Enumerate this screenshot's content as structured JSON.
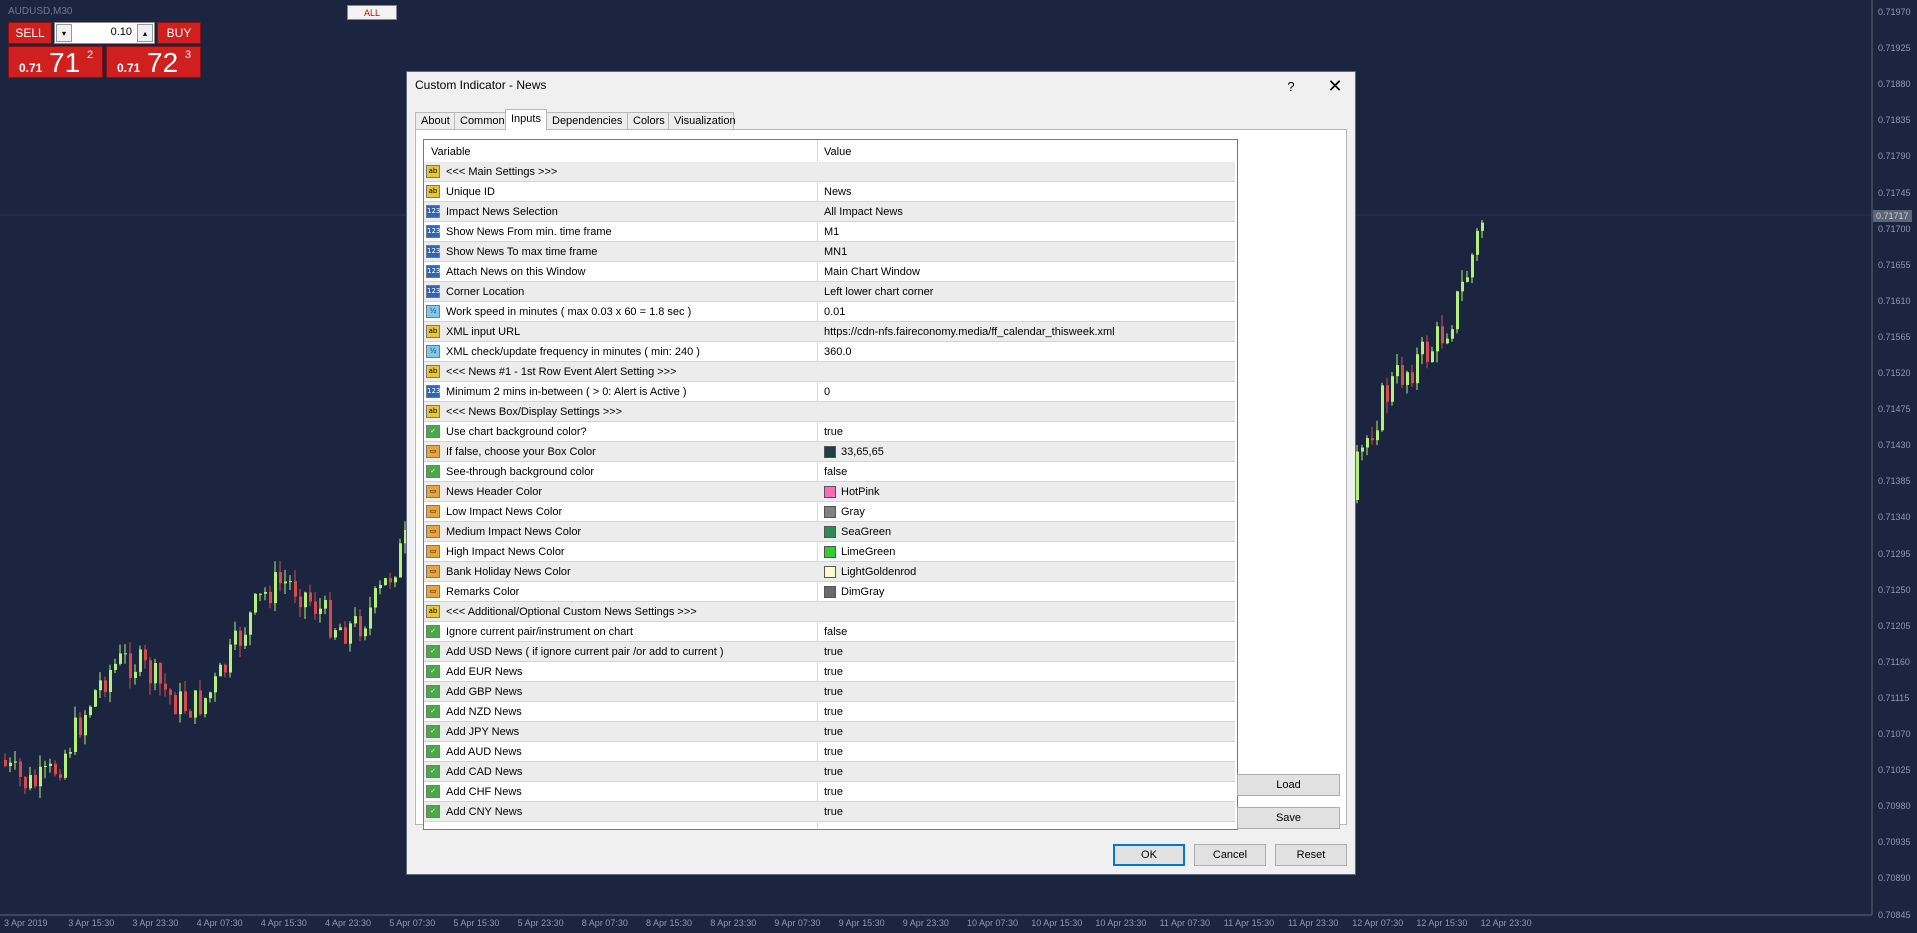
{
  "chart": {
    "symbol_title": "AUDUSD,M30",
    "all_button": "ALL",
    "price_labels": [
      "0.71970",
      "0.71925",
      "0.71880",
      "0.71835",
      "0.71790",
      "0.71745",
      "0.71700",
      "0.71655",
      "0.71610",
      "0.71565",
      "0.71520",
      "0.71475",
      "0.71430",
      "0.71385",
      "0.71340",
      "0.71295",
      "0.71250",
      "0.71205",
      "0.71160",
      "0.71115",
      "0.71070",
      "0.71025",
      "0.70980",
      "0.70935",
      "0.70890",
      "0.70845"
    ],
    "current_price": "0.71717",
    "time_labels": [
      "3 Apr 2019",
      "3 Apr 15:30",
      "3 Apr 23:30",
      "4 Apr 07:30",
      "4 Apr 15:30",
      "4 Apr 23:30",
      "5 Apr 07:30",
      "5 Apr 15:30",
      "5 Apr 23:30",
      "8 Apr 07:30",
      "8 Apr 15:30",
      "8 Apr 23:30",
      "9 Apr 07:30",
      "9 Apr 15:30",
      "9 Apr 23:30",
      "10 Apr 07:30",
      "10 Apr 15:30",
      "10 Apr 23:30",
      "11 Apr 07:30",
      "11 Apr 15:30",
      "11 Apr 23:30",
      "12 Apr 07:30",
      "12 Apr 15:30",
      "12 Apr 23:30"
    ],
    "colors": {
      "background": "#1b2540",
      "bull": "#b5f07a",
      "bear": "#d84b4b",
      "grid": "#2a3552"
    }
  },
  "trade_panel": {
    "sell_label": "SELL",
    "buy_label": "BUY",
    "lot": "0.10",
    "lot_down_icon": "▾",
    "lot_up_icon": "▴",
    "sell_quote": {
      "small": "0.71",
      "big": "71",
      "sup": "2"
    },
    "buy_quote": {
      "small": "0.71",
      "big": "72",
      "sup": "3"
    }
  },
  "dialog": {
    "title": "Custom Indicator - News",
    "help_label": "?",
    "close_label": "✕",
    "tabs": [
      {
        "label": "About",
        "active": false
      },
      {
        "label": "Common",
        "active": false
      },
      {
        "label": "Inputs",
        "active": true
      },
      {
        "label": "Dependencies",
        "active": false
      },
      {
        "label": "Colors",
        "active": false
      },
      {
        "label": "Visualization",
        "active": false
      }
    ],
    "columns": {
      "variable": "Variable",
      "value": "Value"
    },
    "rows": [
      {
        "type": "ab",
        "name": "<<< Main Settings >>>",
        "value": ""
      },
      {
        "type": "ab",
        "name": "Unique ID",
        "value": "News"
      },
      {
        "type": "123",
        "name": "Impact News Selection",
        "value": "All Impact News"
      },
      {
        "type": "123",
        "name": "Show News From min. time frame",
        "value": "M1"
      },
      {
        "type": "123",
        "name": "Show News To max time frame",
        "value": "MN1"
      },
      {
        "type": "123",
        "name": "Attach News on this Window",
        "value": "Main Chart Window"
      },
      {
        "type": "123",
        "name": "Corner Location",
        "value": "Left lower chart corner"
      },
      {
        "type": "dbl",
        "name": "Work speed in minutes ( max 0.03 x 60 = 1.8 sec )",
        "value": "0.01"
      },
      {
        "type": "ab",
        "name": "XML input URL",
        "value": "https://cdn-nfs.faireconomy.media/ff_calendar_thisweek.xml"
      },
      {
        "type": "dbl",
        "name": "XML check/update frequency in minutes ( min: 240 )",
        "value": "360.0"
      },
      {
        "type": "ab",
        "name": "<<< News #1 - 1st Row Event Alert Setting >>>",
        "value": ""
      },
      {
        "type": "123",
        "name": "Minimum 2 mins in-between ( > 0: Alert is Active )",
        "value": "0"
      },
      {
        "type": "ab",
        "name": "<<< News Box/Display Settings >>>",
        "value": ""
      },
      {
        "type": "bool",
        "name": "Use chart background color?",
        "value": "true"
      },
      {
        "type": "clr",
        "name": "If false, choose your Box Color",
        "value": "33,65,65",
        "swatch": "#214141"
      },
      {
        "type": "bool",
        "name": "See-through  background color",
        "value": "false"
      },
      {
        "type": "clr",
        "name": "News Header Color",
        "value": "HotPink",
        "swatch": "#ff69b4"
      },
      {
        "type": "clr",
        "name": "Low Impact News Color",
        "value": "Gray",
        "swatch": "#808080"
      },
      {
        "type": "clr",
        "name": "Medium Impact News Color",
        "value": "SeaGreen",
        "swatch": "#2e8b57"
      },
      {
        "type": "clr",
        "name": "High Impact News Color",
        "value": "LimeGreen",
        "swatch": "#32cd32"
      },
      {
        "type": "clr",
        "name": "Bank Holiday News Color",
        "value": "LightGoldenrod",
        "swatch": "#fafad2"
      },
      {
        "type": "clr",
        "name": "Remarks Color",
        "value": "DimGray",
        "swatch": "#696969"
      },
      {
        "type": "ab",
        "name": "<<< Additional/Optional Custom News Settings >>>",
        "value": ""
      },
      {
        "type": "bool",
        "name": "Ignore current pair/instrument on chart",
        "value": "false"
      },
      {
        "type": "bool",
        "name": "Add USD News ( if ignore current pair /or add to current )",
        "value": "true"
      },
      {
        "type": "bool",
        "name": "Add EUR News",
        "value": "true"
      },
      {
        "type": "bool",
        "name": "Add GBP News",
        "value": "true"
      },
      {
        "type": "bool",
        "name": "Add NZD News",
        "value": "true"
      },
      {
        "type": "bool",
        "name": "Add JPY News",
        "value": "true"
      },
      {
        "type": "bool",
        "name": "Add AUD News",
        "value": "true"
      },
      {
        "type": "bool",
        "name": "Add CAD News",
        "value": "true"
      },
      {
        "type": "bool",
        "name": "Add CHF News",
        "value": "true"
      },
      {
        "type": "bool",
        "name": "Add CNY News",
        "value": "true"
      }
    ],
    "icon_glyphs": {
      "ab": "ab",
      "123": "123",
      "dbl": "½",
      "bool": "✓",
      "clr": "▭"
    },
    "load_label": "Load",
    "save_label": "Save",
    "ok_label": "OK",
    "cancel_label": "Cancel",
    "reset_label": "Reset"
  }
}
